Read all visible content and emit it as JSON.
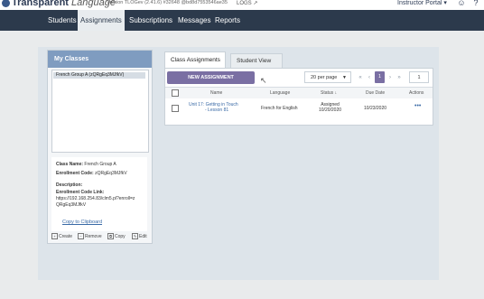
{
  "header": {
    "logo_text": "Transparent",
    "logo_sub": "Language",
    "version": "Version TLOGev (2.41.6) #32648 @bd8d7553546ae35",
    "logs_label": "LOGS",
    "portal_label": "Instructor Portal"
  },
  "nav": {
    "items": [
      {
        "label": "Students"
      },
      {
        "label": "Assignments"
      },
      {
        "label": "Subscriptions"
      },
      {
        "label": "Messages"
      },
      {
        "label": "Reports"
      }
    ],
    "active": "Assignments"
  },
  "classes_panel": {
    "title": "My Classes",
    "items": [
      "French Group A (zQRgEq3MJfkV)"
    ],
    "info": {
      "class_name_label": "Class Name:",
      "class_name": "French Group A",
      "code_label": "Enrollment Code:",
      "code": "zQRgEq3MJfkV",
      "description_label": "Description:",
      "link_label": "Enrollment Code Link:",
      "link_line1": "https://192.168.254.83/clm5.pl?enroll=z",
      "link_line2": "QRgEq3MJfkV"
    },
    "copy_label": "Copy to Clipboard",
    "actions": [
      "Create",
      "Remove",
      "Copy",
      "Edit"
    ]
  },
  "tabs": [
    "Class Assignments",
    "Student View"
  ],
  "toolbar": {
    "new_button": "NEW ASSIGNMENT",
    "per_page": "20 per page",
    "current_page": "1",
    "page_input": "1",
    "pager_first": "«",
    "pager_prev": "‹",
    "pager_next": "›",
    "pager_last": "»"
  },
  "table": {
    "columns": [
      "Name",
      "Language",
      "Status",
      "Due Date",
      "Actions"
    ],
    "sort_indicator": "↓",
    "rows": [
      {
        "name_line1": "Unit 17: Getting in Touch",
        "name_line2": "- Lesson 81",
        "language": "French for English",
        "status_line1": "Assigned",
        "status_line2": "10/20/2020",
        "due_date": "10/23/2020",
        "actions": "•••"
      }
    ]
  },
  "colors": {
    "nav_bg": "#2c3a4c",
    "panel_header": "#7f9cc0",
    "button_purple": "#7a6fa3",
    "link_blue": "#3a6aa6"
  }
}
